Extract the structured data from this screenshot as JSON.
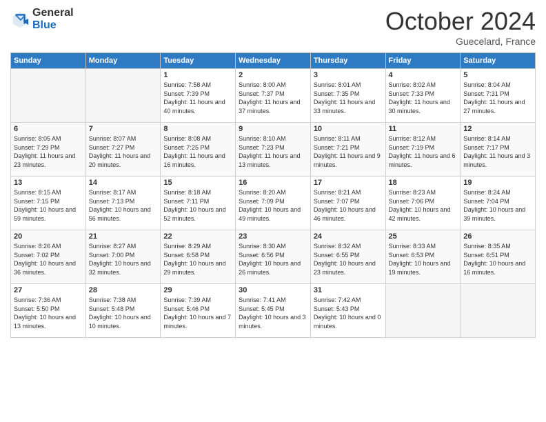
{
  "logo": {
    "general": "General",
    "blue": "Blue"
  },
  "header": {
    "month": "October 2024",
    "location": "Guecelard, France"
  },
  "weekdays": [
    "Sunday",
    "Monday",
    "Tuesday",
    "Wednesday",
    "Thursday",
    "Friday",
    "Saturday"
  ],
  "weeks": [
    [
      {
        "day": "",
        "empty": true
      },
      {
        "day": "",
        "empty": true
      },
      {
        "day": "1",
        "sunrise": "Sunrise: 7:58 AM",
        "sunset": "Sunset: 7:39 PM",
        "daylight": "Daylight: 11 hours and 40 minutes."
      },
      {
        "day": "2",
        "sunrise": "Sunrise: 8:00 AM",
        "sunset": "Sunset: 7:37 PM",
        "daylight": "Daylight: 11 hours and 37 minutes."
      },
      {
        "day": "3",
        "sunrise": "Sunrise: 8:01 AM",
        "sunset": "Sunset: 7:35 PM",
        "daylight": "Daylight: 11 hours and 33 minutes."
      },
      {
        "day": "4",
        "sunrise": "Sunrise: 8:02 AM",
        "sunset": "Sunset: 7:33 PM",
        "daylight": "Daylight: 11 hours and 30 minutes."
      },
      {
        "day": "5",
        "sunrise": "Sunrise: 8:04 AM",
        "sunset": "Sunset: 7:31 PM",
        "daylight": "Daylight: 11 hours and 27 minutes."
      }
    ],
    [
      {
        "day": "6",
        "sunrise": "Sunrise: 8:05 AM",
        "sunset": "Sunset: 7:29 PM",
        "daylight": "Daylight: 11 hours and 23 minutes."
      },
      {
        "day": "7",
        "sunrise": "Sunrise: 8:07 AM",
        "sunset": "Sunset: 7:27 PM",
        "daylight": "Daylight: 11 hours and 20 minutes."
      },
      {
        "day": "8",
        "sunrise": "Sunrise: 8:08 AM",
        "sunset": "Sunset: 7:25 PM",
        "daylight": "Daylight: 11 hours and 16 minutes."
      },
      {
        "day": "9",
        "sunrise": "Sunrise: 8:10 AM",
        "sunset": "Sunset: 7:23 PM",
        "daylight": "Daylight: 11 hours and 13 minutes."
      },
      {
        "day": "10",
        "sunrise": "Sunrise: 8:11 AM",
        "sunset": "Sunset: 7:21 PM",
        "daylight": "Daylight: 11 hours and 9 minutes."
      },
      {
        "day": "11",
        "sunrise": "Sunrise: 8:12 AM",
        "sunset": "Sunset: 7:19 PM",
        "daylight": "Daylight: 11 hours and 6 minutes."
      },
      {
        "day": "12",
        "sunrise": "Sunrise: 8:14 AM",
        "sunset": "Sunset: 7:17 PM",
        "daylight": "Daylight: 11 hours and 3 minutes."
      }
    ],
    [
      {
        "day": "13",
        "sunrise": "Sunrise: 8:15 AM",
        "sunset": "Sunset: 7:15 PM",
        "daylight": "Daylight: 10 hours and 59 minutes."
      },
      {
        "day": "14",
        "sunrise": "Sunrise: 8:17 AM",
        "sunset": "Sunset: 7:13 PM",
        "daylight": "Daylight: 10 hours and 56 minutes."
      },
      {
        "day": "15",
        "sunrise": "Sunrise: 8:18 AM",
        "sunset": "Sunset: 7:11 PM",
        "daylight": "Daylight: 10 hours and 52 minutes."
      },
      {
        "day": "16",
        "sunrise": "Sunrise: 8:20 AM",
        "sunset": "Sunset: 7:09 PM",
        "daylight": "Daylight: 10 hours and 49 minutes."
      },
      {
        "day": "17",
        "sunrise": "Sunrise: 8:21 AM",
        "sunset": "Sunset: 7:07 PM",
        "daylight": "Daylight: 10 hours and 46 minutes."
      },
      {
        "day": "18",
        "sunrise": "Sunrise: 8:23 AM",
        "sunset": "Sunset: 7:06 PM",
        "daylight": "Daylight: 10 hours and 42 minutes."
      },
      {
        "day": "19",
        "sunrise": "Sunrise: 8:24 AM",
        "sunset": "Sunset: 7:04 PM",
        "daylight": "Daylight: 10 hours and 39 minutes."
      }
    ],
    [
      {
        "day": "20",
        "sunrise": "Sunrise: 8:26 AM",
        "sunset": "Sunset: 7:02 PM",
        "daylight": "Daylight: 10 hours and 36 minutes."
      },
      {
        "day": "21",
        "sunrise": "Sunrise: 8:27 AM",
        "sunset": "Sunset: 7:00 PM",
        "daylight": "Daylight: 10 hours and 32 minutes."
      },
      {
        "day": "22",
        "sunrise": "Sunrise: 8:29 AM",
        "sunset": "Sunset: 6:58 PM",
        "daylight": "Daylight: 10 hours and 29 minutes."
      },
      {
        "day": "23",
        "sunrise": "Sunrise: 8:30 AM",
        "sunset": "Sunset: 6:56 PM",
        "daylight": "Daylight: 10 hours and 26 minutes."
      },
      {
        "day": "24",
        "sunrise": "Sunrise: 8:32 AM",
        "sunset": "Sunset: 6:55 PM",
        "daylight": "Daylight: 10 hours and 23 minutes."
      },
      {
        "day": "25",
        "sunrise": "Sunrise: 8:33 AM",
        "sunset": "Sunset: 6:53 PM",
        "daylight": "Daylight: 10 hours and 19 minutes."
      },
      {
        "day": "26",
        "sunrise": "Sunrise: 8:35 AM",
        "sunset": "Sunset: 6:51 PM",
        "daylight": "Daylight: 10 hours and 16 minutes."
      }
    ],
    [
      {
        "day": "27",
        "sunrise": "Sunrise: 7:36 AM",
        "sunset": "Sunset: 5:50 PM",
        "daylight": "Daylight: 10 hours and 13 minutes."
      },
      {
        "day": "28",
        "sunrise": "Sunrise: 7:38 AM",
        "sunset": "Sunset: 5:48 PM",
        "daylight": "Daylight: 10 hours and 10 minutes."
      },
      {
        "day": "29",
        "sunrise": "Sunrise: 7:39 AM",
        "sunset": "Sunset: 5:46 PM",
        "daylight": "Daylight: 10 hours and 7 minutes."
      },
      {
        "day": "30",
        "sunrise": "Sunrise: 7:41 AM",
        "sunset": "Sunset: 5:45 PM",
        "daylight": "Daylight: 10 hours and 3 minutes."
      },
      {
        "day": "31",
        "sunrise": "Sunrise: 7:42 AM",
        "sunset": "Sunset: 5:43 PM",
        "daylight": "Daylight: 10 hours and 0 minutes."
      },
      {
        "day": "",
        "empty": true
      },
      {
        "day": "",
        "empty": true
      }
    ]
  ]
}
